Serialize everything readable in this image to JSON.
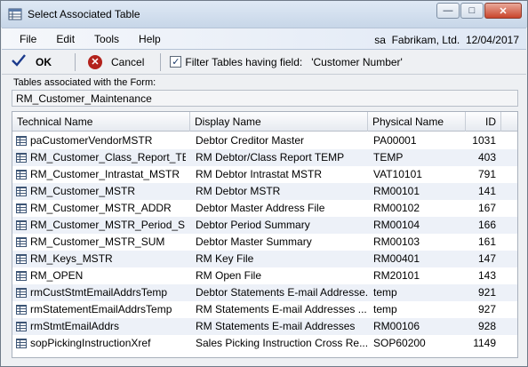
{
  "window": {
    "title": "Select Associated Table"
  },
  "menu": {
    "items": [
      "File",
      "Edit",
      "Tools",
      "Help"
    ],
    "status": "sa  Fabrikam, Ltd.  12/04/2017"
  },
  "toolbar": {
    "ok_label": "OK",
    "cancel_label": "Cancel",
    "filter_label": "Filter Tables having field:",
    "filter_field": "'Customer Number'"
  },
  "form": {
    "label": "Tables associated with the Form:",
    "value": "RM_Customer_Maintenance"
  },
  "grid": {
    "columns": [
      "Technical Name",
      "Display Name",
      "Physical Name",
      "ID"
    ],
    "rows": [
      [
        "paCustomerVendorMSTR",
        "Debtor Creditor Master",
        "PA00001",
        "1031"
      ],
      [
        "RM_Customer_Class_Report_TE...",
        "RM Debtor/Class Report TEMP",
        "TEMP",
        "403"
      ],
      [
        "RM_Customer_Intrastat_MSTR",
        "RM Debtor Intrastat MSTR",
        "VAT10101",
        "791"
      ],
      [
        "RM_Customer_MSTR",
        "RM Debtor MSTR",
        "RM00101",
        "141"
      ],
      [
        "RM_Customer_MSTR_ADDR",
        "Debtor Master Address File",
        "RM00102",
        "167"
      ],
      [
        "RM_Customer_MSTR_Period_S...",
        "Debtor Period Summary",
        "RM00104",
        "166"
      ],
      [
        "RM_Customer_MSTR_SUM",
        "Debtor Master Summary",
        "RM00103",
        "161"
      ],
      [
        "RM_Keys_MSTR",
        "RM Key File",
        "RM00401",
        "147"
      ],
      [
        "RM_OPEN",
        "RM Open File",
        "RM20101",
        "143"
      ],
      [
        "rmCustStmtEmailAddrsTemp",
        "Debtor Statements E-mail Addresse...",
        "temp",
        "921"
      ],
      [
        "rmStatementEmailAddrsTemp",
        "RM Statements E-mail Addresses ...",
        "temp",
        "927"
      ],
      [
        "rmStmtEmailAddrs",
        "RM Statements E-mail Addresses",
        "RM00106",
        "928"
      ],
      [
        "sopPickingInstructionXref",
        "Sales Picking Instruction Cross Re...",
        "SOP60200",
        "1149"
      ]
    ]
  }
}
